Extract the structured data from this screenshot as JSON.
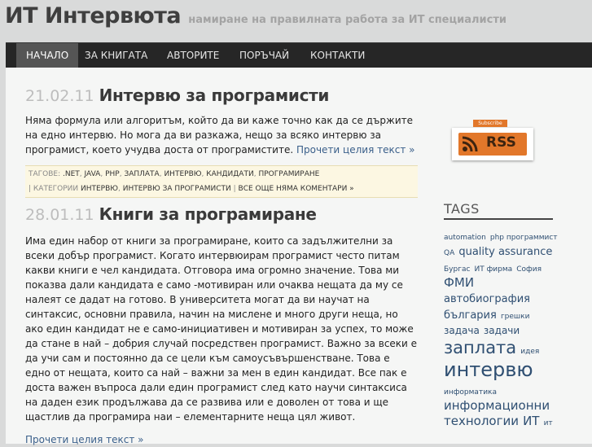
{
  "site": {
    "title": "ИТ Интервюта",
    "tagline": "намиране на правилната работа за ИТ специалисти"
  },
  "nav": {
    "items": [
      {
        "label": "Начало",
        "active": true
      },
      {
        "label": "За книгата",
        "active": false
      },
      {
        "label": "Авторите",
        "active": false
      },
      {
        "label": "Поръчай",
        "active": false
      },
      {
        "label": "Контакти",
        "active": false
      }
    ]
  },
  "posts": [
    {
      "date": "21.02.11",
      "title": "Интервю за програмисти",
      "excerpt": "Няма формула или алгоритъм, който да ви каже точно как да се държите на едно интервю. Но мога да ви разкажа, нещо за всяко интервю за програмист, което учудва доста от програмистите.",
      "more_label": "Прочети целия текст »",
      "tags_label": "Тагове:",
      "tags": [
        ".net",
        "java",
        "php",
        "заплата",
        "интервю",
        "кандидати",
        "програмиране"
      ],
      "categories_label": "Категории",
      "categories": [
        "интервю",
        "интервю за програмисти"
      ],
      "comments_label": "Все още няма коментари »"
    },
    {
      "date": "28.01.11",
      "title": "Книги за програмиране",
      "excerpt": "Има един набор от книги за програмиране, които са задължителни за всеки добър програмист.  Когато интервюирам програмист често питам какви книги е чел кандидата.  Отговора има огромно значение. Това ми показва дали кандидата е  само -мотивиран  или очаква нещата да му се налеят се дадат на готово. В университета могат да ви научат на синтаксис, основни правила, начин на мислене и много други неща, но ако един кандидат не е само-инициативен и мотивиран за успех, то може да стане в най – добрия случай посредствен програмист.    Важно за всеки е да учи сам и постоянно да се цели към самоусъвършенстване.  Това е едно от нещата, които са най – важни за мен в един кандидат. Все пак е доста важен въпроса дали един програмист след като научи синтаксиса на даден език продължава да се развива или е доволен от това и ще щастлив да програмира наи – елементарните неща цял живот.",
      "more_label": "Прочети целия текст »"
    }
  ],
  "sidebar": {
    "rss_subscribe": "Subscribe",
    "rss_label": "RSS",
    "rss_icon": "rss-icon",
    "tags_title": "Tags",
    "tag_cloud": [
      {
        "label": "automation",
        "size": 9,
        "color": "#2f4f72"
      },
      {
        "label": "php программист",
        "size": 9,
        "color": "#2f4f72"
      },
      {
        "label": "QA",
        "size": 9,
        "color": "#2f4f72"
      },
      {
        "label": "quality assurance",
        "size": 13,
        "color": "#2f4f72"
      },
      {
        "label": "Бургас",
        "size": 9,
        "color": "#2f4f72"
      },
      {
        "label": "ИТ фирма",
        "size": 9,
        "color": "#2f4f72"
      },
      {
        "label": "София",
        "size": 9,
        "color": "#2f4f72"
      },
      {
        "label": "ФМИ",
        "size": 15,
        "color": "#2f4f72"
      },
      {
        "label": "автобиография",
        "size": 13,
        "color": "#2f4f72"
      },
      {
        "label": "българия",
        "size": 13,
        "color": "#2f4f72"
      },
      {
        "label": "грешки",
        "size": 9,
        "color": "#2f4f72"
      },
      {
        "label": "задача",
        "size": 12,
        "color": "#2f4f72"
      },
      {
        "label": "задачи",
        "size": 12,
        "color": "#2f4f72"
      },
      {
        "label": "заплата",
        "size": 21,
        "color": "#2f4f72"
      },
      {
        "label": "идея",
        "size": 9,
        "color": "#2f4f72"
      },
      {
        "label": "интервю",
        "size": 24,
        "color": "#2f4f72"
      },
      {
        "label": "информатика",
        "size": 9,
        "color": "#2f4f72"
      },
      {
        "label": "информационни технологии",
        "size": 15,
        "color": "#2f4f72"
      },
      {
        "label": "ИТ",
        "size": 15,
        "color": "#2f4f72"
      },
      {
        "label": "ит",
        "size": 9,
        "color": "#2f4f72"
      }
    ]
  }
}
